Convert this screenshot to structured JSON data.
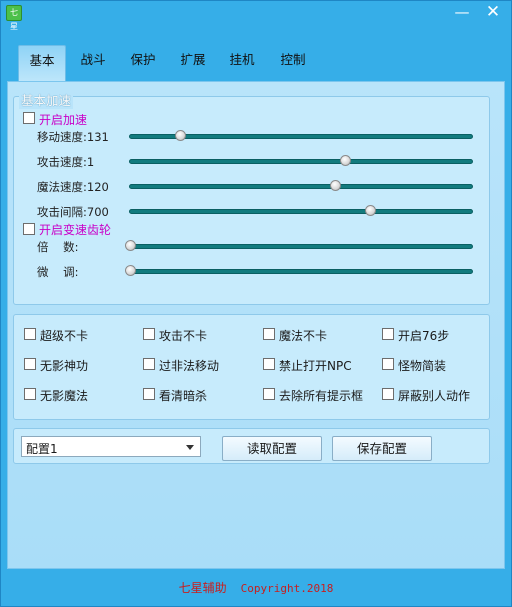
{
  "window": {
    "icon_text": "七星",
    "minimize_glyph": "—",
    "close_glyph": "✕"
  },
  "tabs": [
    {
      "label": "基本",
      "active": true
    },
    {
      "label": "战斗",
      "active": false
    },
    {
      "label": "保护",
      "active": false
    },
    {
      "label": "扩展",
      "active": false
    },
    {
      "label": "挂机",
      "active": false
    },
    {
      "label": "控制",
      "active": false
    }
  ],
  "basic_speed": {
    "legend": "基本加速",
    "enable_speed": {
      "label": "开启加速",
      "checked": false
    },
    "sliders": [
      {
        "label": "移动速度:131",
        "fraction": 0.146
      },
      {
        "label": "攻击速度:1",
        "fraction": 0.628
      },
      {
        "label": "魔法速度:120",
        "fraction": 0.599
      },
      {
        "label": "攻击间隔:700",
        "fraction": 0.703
      }
    ],
    "enable_gear": {
      "label": "开启变速齿轮",
      "checked": false
    },
    "gear_sliders": [
      {
        "label": "倍    数:",
        "fraction": 0.0
      },
      {
        "label": "微    调:",
        "fraction": 0.0
      }
    ]
  },
  "options": [
    [
      {
        "label": "超级不卡",
        "checked": false
      },
      {
        "label": "攻击不卡",
        "checked": false
      },
      {
        "label": "魔法不卡",
        "checked": false
      },
      {
        "label": "开启76步",
        "checked": false
      }
    ],
    [
      {
        "label": "无影神功",
        "checked": false
      },
      {
        "label": "过非法移动",
        "checked": false
      },
      {
        "label": "禁止打开NPC",
        "checked": false
      },
      {
        "label": "怪物简装",
        "checked": false
      }
    ],
    [
      {
        "label": "无影魔法",
        "checked": false
      },
      {
        "label": "看清暗杀",
        "checked": false
      },
      {
        "label": "去除所有提示框",
        "checked": false
      },
      {
        "label": "屏蔽别人动作",
        "checked": false
      }
    ]
  ],
  "config": {
    "selected": "配置1",
    "load_label": "读取配置",
    "save_label": "保存配置"
  },
  "footer": {
    "brand": "七星辅助",
    "copyright": "Copyright.2018"
  }
}
